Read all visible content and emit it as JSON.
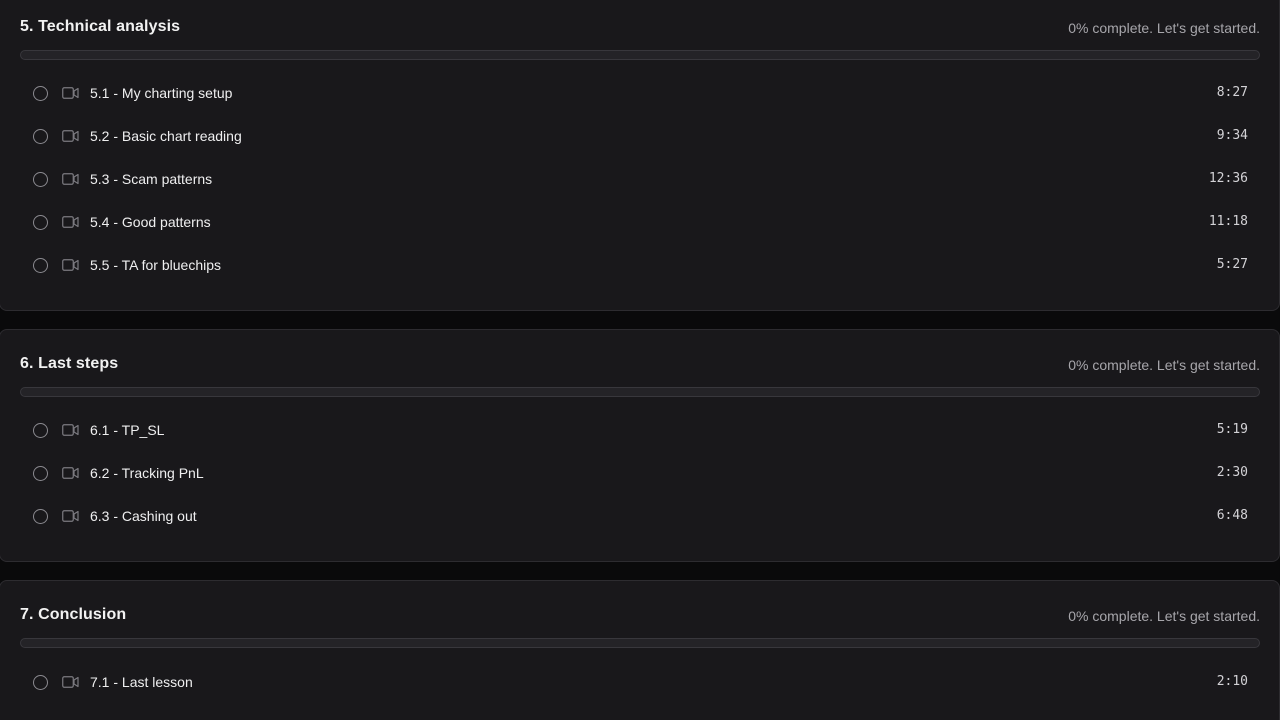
{
  "theme": {
    "background": "#0a0a0b",
    "card": "#19181b",
    "border": "#2d2c30",
    "progress_track": "#242327",
    "muted_text": "#a7a6ab"
  },
  "sections": [
    {
      "title": "5. Technical analysis",
      "status": "0% complete. Let's get started.",
      "progress": 0,
      "lessons": [
        {
          "title": "5.1 - My charting setup",
          "duration": "8:27",
          "icon": "video-icon",
          "completed": false
        },
        {
          "title": "5.2 - Basic chart reading",
          "duration": "9:34",
          "icon": "video-icon",
          "completed": false
        },
        {
          "title": "5.3 - Scam patterns",
          "duration": "12:36",
          "icon": "video-icon",
          "completed": false
        },
        {
          "title": "5.4 - Good patterns",
          "duration": "11:18",
          "icon": "video-icon",
          "completed": false
        },
        {
          "title": "5.5 - TA for bluechips",
          "duration": "5:27",
          "icon": "video-icon",
          "completed": false
        }
      ]
    },
    {
      "title": "6. Last steps",
      "status": "0% complete. Let's get started.",
      "progress": 0,
      "lessons": [
        {
          "title": "6.1 - TP_SL",
          "duration": "5:19",
          "icon": "video-icon",
          "completed": false
        },
        {
          "title": "6.2 - Tracking PnL",
          "duration": "2:30",
          "icon": "video-icon",
          "completed": false
        },
        {
          "title": "6.3 - Cashing out",
          "duration": "6:48",
          "icon": "video-icon",
          "completed": false
        }
      ]
    },
    {
      "title": "7. Conclusion",
      "status": "0% complete. Let's get started.",
      "progress": 0,
      "lessons": [
        {
          "title": "7.1 - Last lesson",
          "duration": "2:10",
          "icon": "video-icon",
          "completed": false
        }
      ]
    }
  ]
}
